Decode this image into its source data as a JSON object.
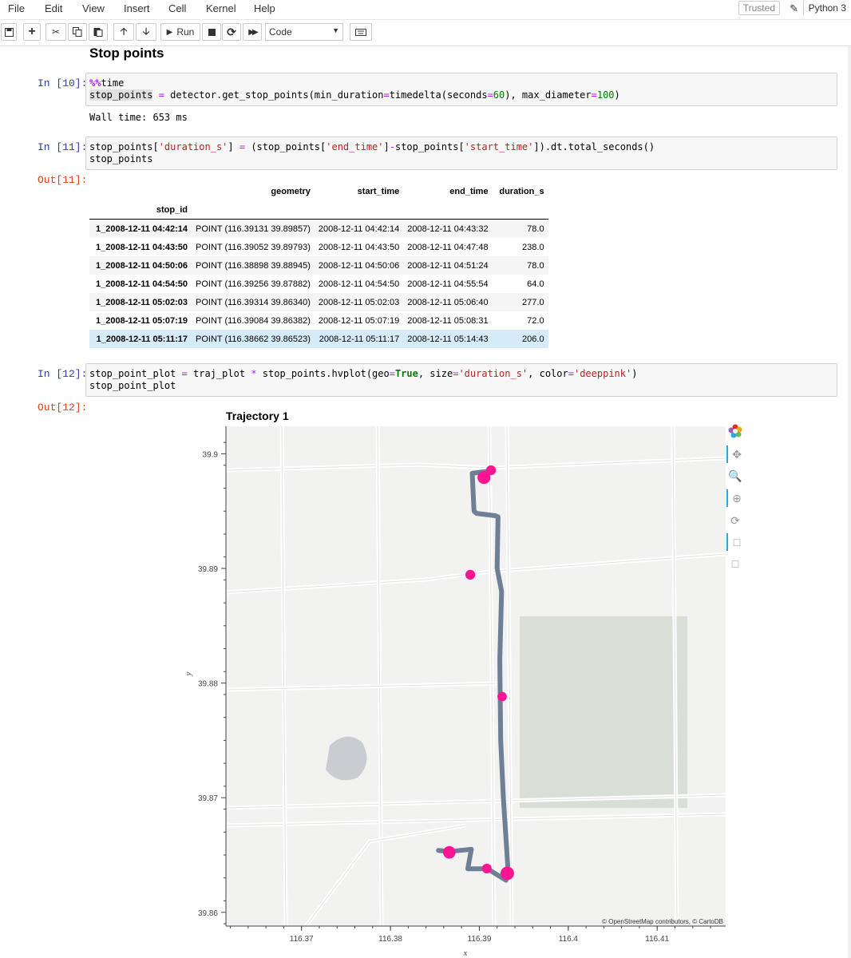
{
  "menu": [
    "File",
    "Edit",
    "View",
    "Insert",
    "Cell",
    "Kernel",
    "Help"
  ],
  "status": {
    "trusted": "Trusted",
    "kernel": "Python 3"
  },
  "toolbar": {
    "run_label": "Run",
    "cell_type": "Code"
  },
  "section_title": "Stop points",
  "cells": [
    {
      "prompt_in": "In [10]:",
      "output": "Wall time: 653 ms"
    },
    {
      "prompt_in": "In [11]:",
      "prompt_out": "Out[11]:"
    },
    {
      "prompt_in": "In [12]:",
      "prompt_out": "Out[12]:"
    }
  ],
  "table": {
    "columns": [
      "geometry",
      "start_time",
      "end_time",
      "duration_s"
    ],
    "index_name": "stop_id",
    "rows": [
      [
        "1_2008-12-11 04:42:14",
        "POINT (116.39131 39.89857)",
        "2008-12-11 04:42:14",
        "2008-12-11 04:43:32",
        "78.0"
      ],
      [
        "1_2008-12-11 04:43:50",
        "POINT (116.39052 39.89793)",
        "2008-12-11 04:43:50",
        "2008-12-11 04:47:48",
        "238.0"
      ],
      [
        "1_2008-12-11 04:50:06",
        "POINT (116.38898 39.88945)",
        "2008-12-11 04:50:06",
        "2008-12-11 04:51:24",
        "78.0"
      ],
      [
        "1_2008-12-11 04:54:50",
        "POINT (116.39256 39.87882)",
        "2008-12-11 04:54:50",
        "2008-12-11 04:55:54",
        "64.0"
      ],
      [
        "1_2008-12-11 05:02:03",
        "POINT (116.39314 39.86340)",
        "2008-12-11 05:02:03",
        "2008-12-11 05:06:40",
        "277.0"
      ],
      [
        "1_2008-12-11 05:07:19",
        "POINT (116.39084 39.86382)",
        "2008-12-11 05:07:19",
        "2008-12-11 05:08:31",
        "72.0"
      ],
      [
        "1_2008-12-11 05:11:17",
        "POINT (116.38662 39.86523)",
        "2008-12-11 05:11:17",
        "2008-12-11 05:14:43",
        "206.0"
      ]
    ]
  },
  "plot": {
    "title": "Trajectory 1",
    "attribution": "© OpenStreetMap contributors, © CartoDB",
    "colors": {
      "trajectory": "#6e7f96",
      "stop": "#ff1493",
      "map_bg": "#f2f2f0"
    }
  },
  "chart_data": {
    "type": "scatter",
    "title": "Trajectory 1",
    "xlabel": "x",
    "ylabel": "y",
    "xlim": [
      116.3615,
      116.4177
    ],
    "ylim": [
      39.8588,
      39.9024
    ],
    "xticks": [
      "116.37",
      "116.38",
      "116.39",
      "116.4",
      "116.41"
    ],
    "yticks": [
      "39.86",
      "39.87",
      "39.88",
      "39.89",
      "39.9"
    ],
    "xtick_values": [
      116.37,
      116.38,
      116.39,
      116.4,
      116.41
    ],
    "ytick_values": [
      39.86,
      39.87,
      39.88,
      39.89,
      39.9
    ],
    "series": [
      {
        "x": [
          116.3912,
          116.3892,
          116.3894,
          116.3897,
          116.3918,
          116.3921,
          116.392,
          116.3925,
          116.3923,
          116.3924,
          116.3927,
          116.3932,
          116.393,
          116.3909,
          116.3887,
          116.3891,
          116.3866,
          116.3854
        ],
        "y": [
          39.8985,
          39.8983,
          39.895,
          39.8948,
          39.8946,
          39.8945,
          39.89,
          39.888,
          39.882,
          39.875,
          39.87,
          39.864,
          39.8628,
          39.8638,
          39.8638,
          39.8655,
          39.8653,
          39.8654
        ]
      },
      {
        "x": [
          116.39131,
          116.39052,
          116.38898,
          116.39256,
          116.39314,
          116.39084,
          116.38662
        ],
        "y": [
          39.89857,
          39.89793,
          39.88945,
          39.87882,
          39.8634,
          39.86382,
          39.86523
        ],
        "size": [
          78.0,
          238.0,
          78.0,
          64.0,
          277.0,
          72.0,
          206.0
        ]
      }
    ]
  }
}
